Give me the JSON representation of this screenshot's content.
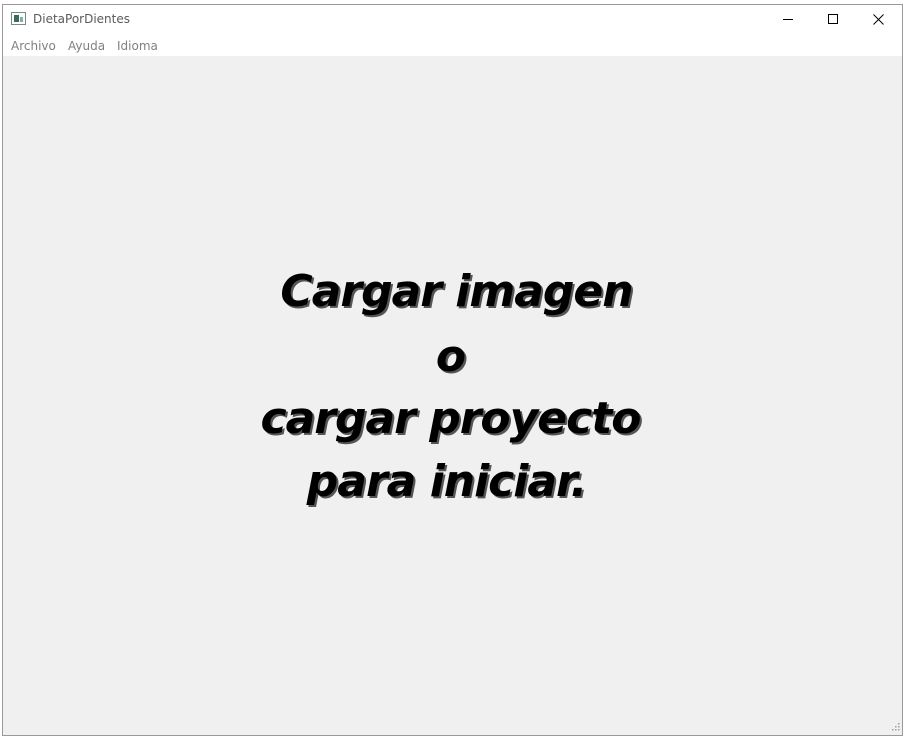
{
  "window": {
    "title": "DietaPorDientes",
    "icon": "app-window-icon",
    "controls": {
      "minimize_icon": "minimize-icon",
      "maximize_icon": "maximize-icon",
      "close_icon": "close-icon"
    }
  },
  "menu": {
    "items": [
      {
        "label": "Archivo"
      },
      {
        "label": "Ayuda"
      },
      {
        "label": "Idioma"
      }
    ]
  },
  "main": {
    "prompt_lines": [
      "Cargar imagen",
      "o",
      "cargar proyecto",
      "para iniciar."
    ]
  },
  "colors": {
    "titlebar_bg": "#ffffff",
    "content_bg": "#f0f0f0",
    "menu_text": "#808080",
    "prompt_text": "#000000"
  }
}
